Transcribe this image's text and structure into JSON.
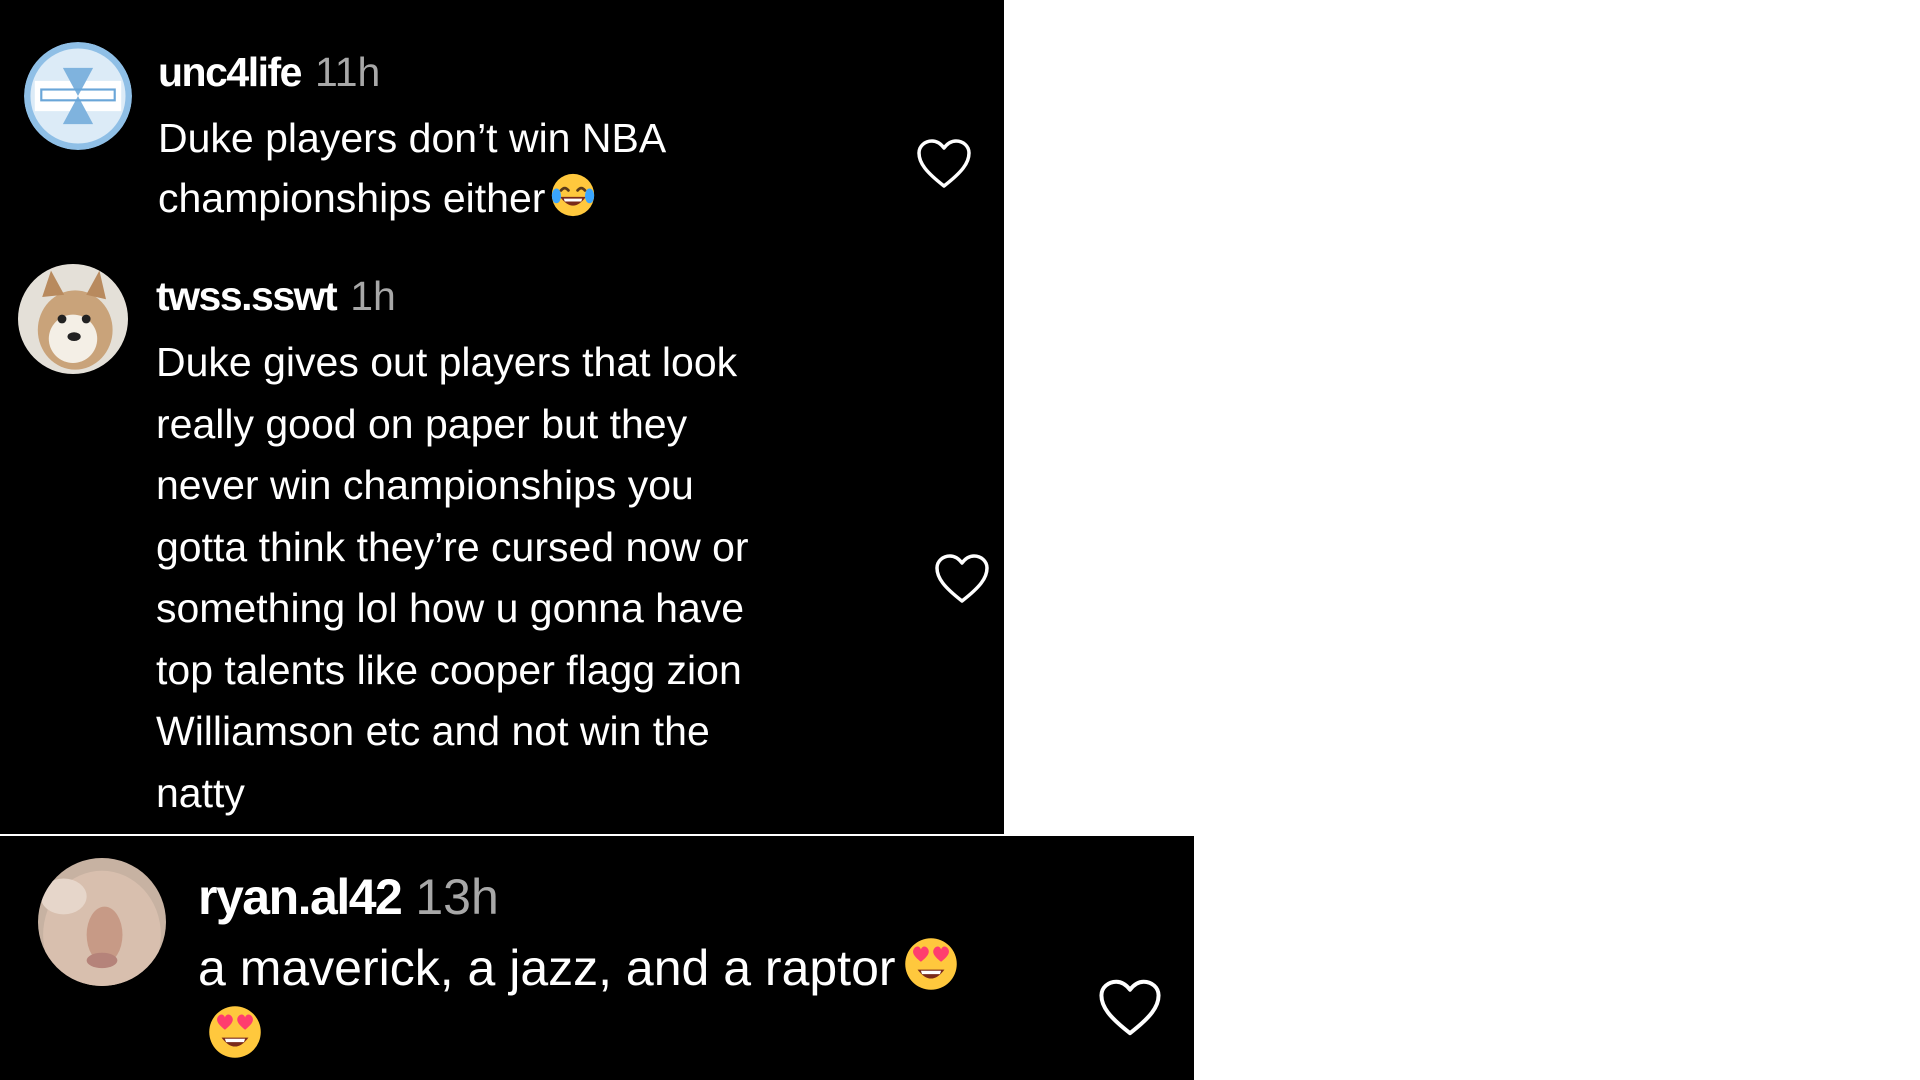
{
  "comments": [
    {
      "username": "unc4life",
      "time": "11h",
      "lines": [
        "Duke players don’t win NBA",
        "championships either"
      ],
      "emoji_after_line": 1,
      "emoji_icon": "face-with-tears-of-joy-icon"
    },
    {
      "username": "twss.sswt",
      "time": "1h",
      "lines": [
        "Duke gives out players that look",
        "really good on paper but they",
        "never win championships you",
        "gotta think they’re cursed now or",
        "something lol how u gonna have",
        "top talents like cooper flagg zion",
        "Williamson etc and not win the",
        "natty"
      ]
    },
    {
      "username": "ryan.al42",
      "time": "13h",
      "lines": [
        "a maverick, a jazz, and a raptor"
      ],
      "emoji_icon": "smiling-face-with-heart-eyes-icon"
    }
  ],
  "icons": {
    "like": "heart-outline-icon"
  },
  "colors": {
    "background": "#000000",
    "text": "#ffffff",
    "timestamp": "#a8a8a8"
  }
}
